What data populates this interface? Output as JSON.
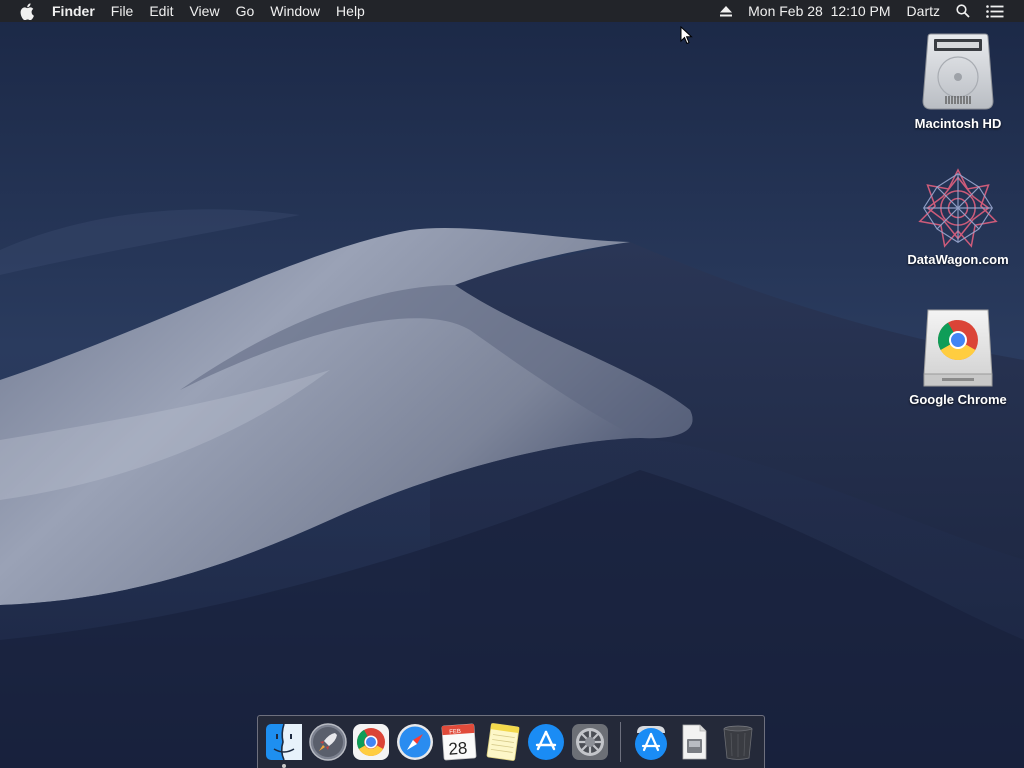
{
  "menubar": {
    "apple_icon": "apple-logo-icon",
    "app_name": "Finder",
    "menus": [
      "File",
      "Edit",
      "View",
      "Go",
      "Window",
      "Help"
    ],
    "eject_icon": "eject-icon",
    "datetime": "Mon Feb 28  12:10 PM",
    "user": "Dartz",
    "search_icon": "spotlight-search-icon",
    "notification_icon": "notification-center-icon"
  },
  "desktop": {
    "icons": [
      {
        "label": "Macintosh HD",
        "icon": "hard-drive-icon"
      },
      {
        "label": "DataWagon.com",
        "icon": "network-volume-icon"
      },
      {
        "label": "Google Chrome",
        "icon": "chrome-disk-image-icon"
      }
    ]
  },
  "dock": {
    "apps": [
      {
        "name": "Finder",
        "icon": "finder-icon",
        "running": true
      },
      {
        "name": "Launchpad",
        "icon": "launchpad-rocket-icon",
        "running": false
      },
      {
        "name": "Google Chrome",
        "icon": "chrome-icon",
        "running": false
      },
      {
        "name": "Safari",
        "icon": "safari-compass-icon",
        "running": false
      },
      {
        "name": "Calendar",
        "icon": "calendar-icon",
        "running": false,
        "month": "FEB",
        "day": "28"
      },
      {
        "name": "Notes",
        "icon": "notes-icon",
        "running": false
      },
      {
        "name": "App Store",
        "icon": "app-store-icon",
        "running": false
      },
      {
        "name": "System Preferences",
        "icon": "system-preferences-gear-icon",
        "running": false
      }
    ],
    "others": [
      {
        "name": "Applications",
        "icon": "applications-folder-icon"
      },
      {
        "name": "Downloads",
        "icon": "disk-image-document-icon"
      },
      {
        "name": "Trash",
        "icon": "trash-icon"
      }
    ]
  },
  "colors": {
    "menubar_bg": "#222429",
    "sky_top": "#1b2a48",
    "sky_bottom": "#2b3c60",
    "dune_light": "#a9b0c0",
    "dune_shadow": "#1c2640"
  }
}
